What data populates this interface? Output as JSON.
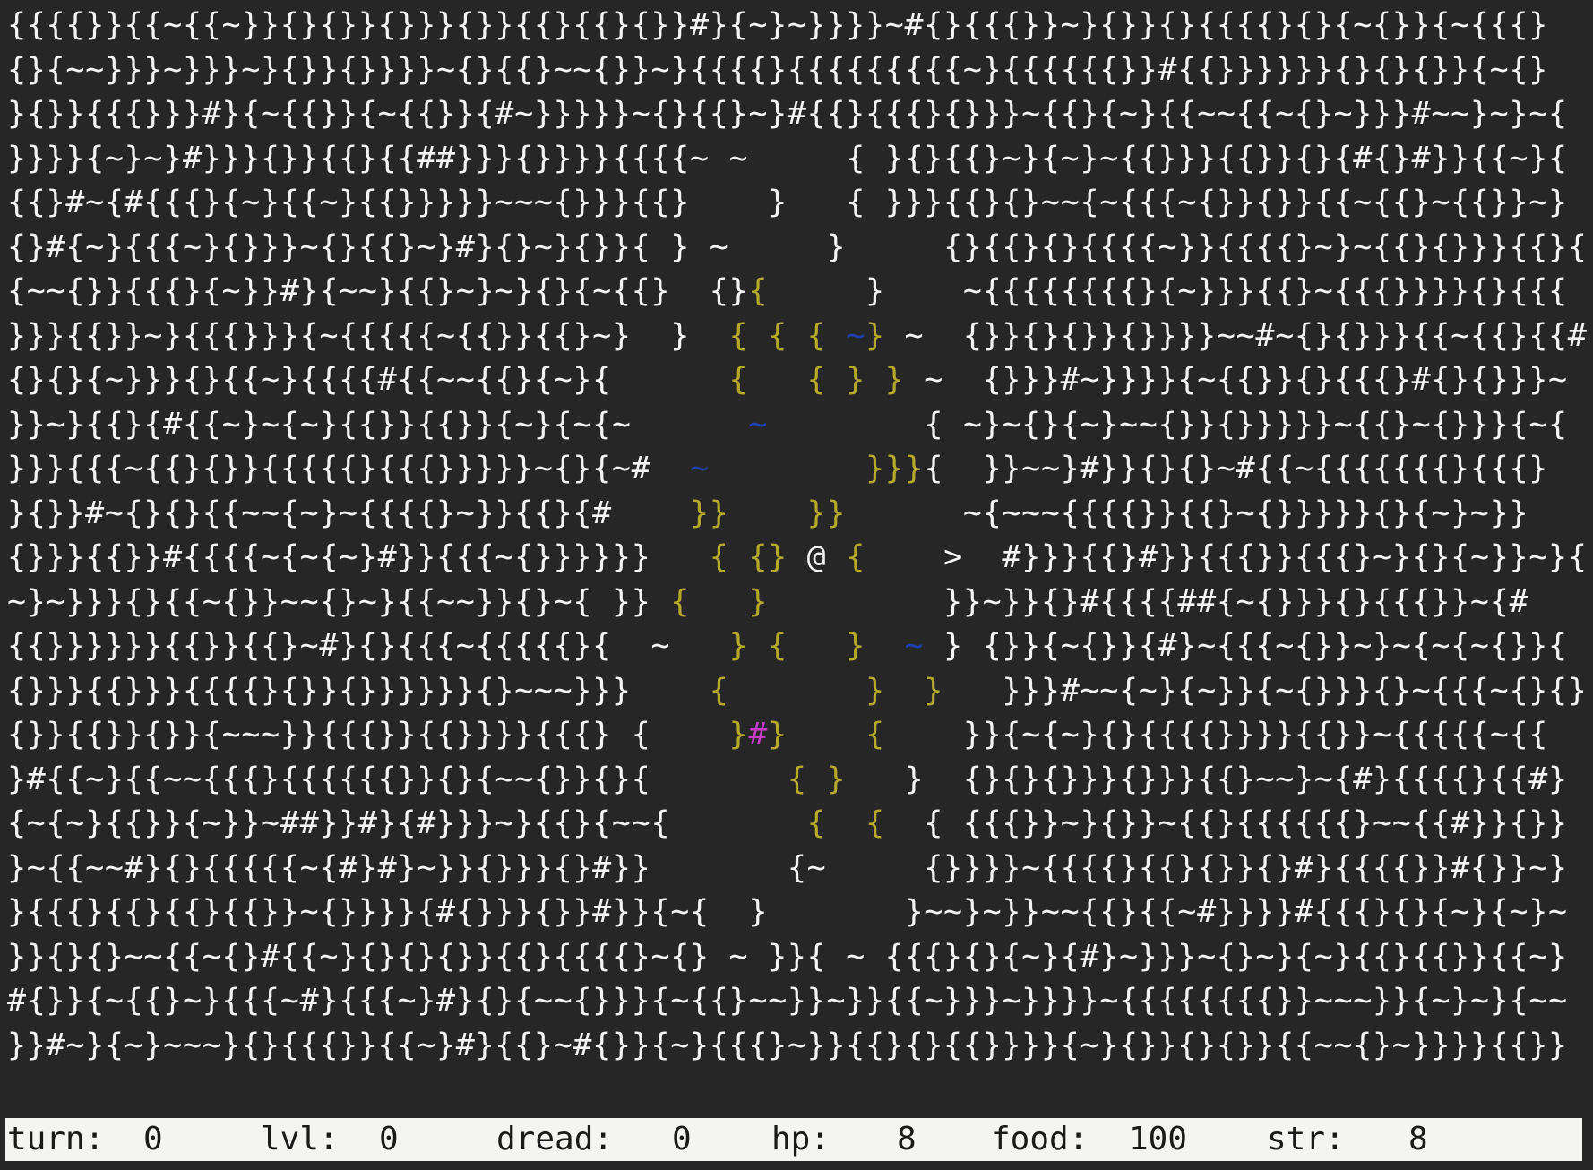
{
  "colors": {
    "background": "#262626",
    "wall": "#f4f4f4",
    "lit_floor": "#b5a82a",
    "water": "#1d3fae",
    "item": "#c63ac6",
    "status_bg": "#f4f5f3",
    "status_text": "#1a1a1a"
  },
  "legend": {
    "{": "wall",
    "}": "wall",
    "~": "water",
    "#": "wall",
    "@": "player",
    ">": "stairs-down"
  },
  "map": {
    "rows": [
      [
        [
          "{{{{}}{{~{{~}}{}{}}{}}}{}}{{}{{}{}}#}{~}~}}}}~#{}{{{}}~}{}}{}{{{{}{}{~{}}{~{{{}",
          "w"
        ]
      ],
      [
        [
          "{}{~~}}}~}}}~}{}}{}}}}~{}{{}~~{}}~}{{{{}{{{{{{{{{~}{{{{{{}}#{{}}}}}}{}{}{}}{~{}",
          "w"
        ]
      ],
      [
        [
          "}{}}{{{}}}#}{~{{}}{~{{}}{#~}}}}}~{}{{}~}#{{}{{{}{}}}~{{}{~}{{~~{{~{}~}}}#~~}~}~{",
          "w"
        ]
      ],
      [
        [
          "}}}}{~}~}#}}}{}}{{}{{##}}}{}}}}{{{{~ ~",
          "w"
        ],
        [
          "     ",
          "w"
        ],
        [
          "{ }{}{{}~}{~}~{{}}}{{}}{}{#{}#}}{{~}{",
          "w"
        ]
      ],
      [
        [
          "{{}#~{#{{{}{~}{{~}{{}}}}}~~~{}}}{{}",
          "w"
        ],
        [
          "    }   ",
          "w"
        ],
        [
          "{ }}}{{}{}~~{~{{{~{}}{}}{{~{{}~{{}}~}",
          "w"
        ]
      ],
      [
        [
          "{}#{~}{{{~}{}}}~{}{{}~}#}{}~}{}}{ } ~",
          "w"
        ],
        [
          "     }     ",
          "w"
        ],
        [
          "{}{{}{}{{{{~}}{{{{}~}~{{}{}}}{{}{",
          "w"
        ]
      ],
      [
        [
          "{~~{}}{{{}{~}}#}{~~}{{}~}~}{}{~{{}  ",
          "w"
        ],
        [
          "{}",
          "w"
        ],
        [
          "{",
          "l"
        ],
        [
          "     }    ",
          "w"
        ],
        [
          "~{{{{{{{{}{~}}}{{}~{{{}}}}{}{{{",
          "w"
        ]
      ],
      [
        [
          "}}}{{}}~}{{{}}}{~{{{{{~{{}}{{}~}  }  ",
          "w"
        ],
        [
          "{ { { ",
          "l"
        ],
        [
          "~",
          "b"
        ],
        [
          "}",
          "l"
        ],
        [
          " ~  ",
          "w"
        ],
        [
          "{}}{}{}}{}}}}~~#~{}{}}}{{~{{}{{#",
          "w"
        ]
      ],
      [
        [
          "{}{}{~}}}{}{{~}{{{{#{{~~{{}{~}{",
          "w"
        ],
        [
          "      ",
          "w"
        ],
        [
          "{   { } }",
          "l"
        ],
        [
          " ~  ",
          "w"
        ],
        [
          "{}}}#~}}}}{~{{}}{}{{{}#{}{}}}~",
          "w"
        ]
      ],
      [
        [
          "}}~}{{}{#{{~}~{~}{{}}{{}}{~}{~{~",
          "w"
        ],
        [
          "      ",
          "w"
        ],
        [
          "~",
          "b"
        ],
        [
          "        ",
          "w"
        ],
        [
          "{ ~}~{}{~}~~{}}{}}}}}~{{}~{}}}{~{",
          "w"
        ]
      ],
      [
        [
          "}}}{{{~{{}{}}{{{{{}{{{}}}}}~{}{~#  ",
          "w"
        ],
        [
          "~",
          "b"
        ],
        [
          "        ",
          "w"
        ],
        [
          "}}}",
          "l"
        ],
        [
          "{  }}~~}#}}{}{}~#{{~{{{{{{{}{{{}",
          "w"
        ]
      ],
      [
        [
          "}{}}#~{}{}{{~~{~}~{{{{}~}}{{}{#    ",
          "w"
        ],
        [
          "}}",
          "l"
        ],
        [
          "    ",
          "w"
        ],
        [
          "}}",
          "l"
        ],
        [
          "      ~{~~~{{{{}}{{}~{}}}}}{}{~}~}}",
          "w"
        ]
      ],
      [
        [
          "{}}}{{}}#{{{{~{~{~}#}}{{{~{}}}}}}   ",
          "w"
        ],
        [
          "{ {}",
          "l"
        ],
        [
          " ",
          "w"
        ],
        [
          "@",
          "p"
        ],
        [
          " ",
          "w"
        ],
        [
          "{",
          "l"
        ],
        [
          "    ",
          "w"
        ],
        [
          ">",
          "s"
        ],
        [
          "  #}}}{{}#}}{{{}}{{{}~}{}{~}}~}{",
          "w"
        ]
      ],
      [
        [
          "~}~}}}{}{{~{}}~~{}~}{{~~}}{}~{ }} ",
          "w"
        ],
        [
          "{",
          "l"
        ],
        [
          "   ",
          "w"
        ],
        [
          "}",
          "l"
        ],
        [
          "         ",
          "w"
        ],
        [
          "}}~}}{}#{{{{##{~{}}}{}{{{}}~{#",
          "w"
        ]
      ],
      [
        [
          "{{}}}}}}{{}}{{}~#}{}{{{~{{{{{}{  ~   ",
          "w"
        ],
        [
          "} {   }",
          "l"
        ],
        [
          "  ",
          "w"
        ],
        [
          "~",
          "b"
        ],
        [
          " } {}}{~{}}{#}~{{{~{}}~}~{~{~{}}{",
          "w"
        ]
      ],
      [
        [
          "{}}}{{}}}{{{{}{}}{}}}}}}{}~~~}}}    ",
          "w"
        ],
        [
          "{       }  }",
          "l"
        ],
        [
          "   }}}#~~{~}{~}}{~{}}}{}~{{{~{}{}",
          "w"
        ]
      ],
      [
        [
          "{}}{{}}{}}{~~~}}{{{}}{{}}}}{{{} {    ",
          "w"
        ],
        [
          "}",
          "l"
        ],
        [
          "#",
          "m"
        ],
        [
          "}",
          "l"
        ],
        [
          "    ",
          "w"
        ],
        [
          "{",
          "l"
        ],
        [
          "    }}{~{~}{}{{{{}}}}{{}}~{{{{{~{{",
          "w"
        ]
      ],
      [
        [
          "}#{{~}{{~~{{{}{{{{{{}}{}{~~{}}{}{       ",
          "w"
        ],
        [
          "{ }",
          "l"
        ],
        [
          "   }  {}{}{}}}{}}}{{}~~}~{#}{{{{}{{#}",
          "w"
        ]
      ],
      [
        [
          "{~{~}{{}}{~}}~##}}#}{#}}}~}{{}{~~{       ",
          "w"
        ],
        [
          "{  {",
          "l"
        ],
        [
          "  { {{{}}~}{}}~{{}{{{{{{}~~{{#}}{}}",
          "w"
        ]
      ],
      [
        [
          "}~{{~~#}{}{{{{{~{#}#}~}}{}}}{}#}}       {~     {}}}}~{{{{}{{}{}}{}#}{{{{}}#{}}~}",
          "w"
        ]
      ],
      [
        [
          "}{{{}{{}{{}{{}}~{}}}}{#{}}}{}}#}}{~{  }       }~~}~}}~~{{}{{~#}}}}#{{{}{}{~}{~}~",
          "w"
        ]
      ],
      [
        [
          "}}{}{}~~{{~{}#{{~}{}{}{}}{{}{{{{}~{} ~ }}{ ~ {{{}{}{~}{#}~}}}~{}~}{~}{{}{{}}{{~}",
          "w"
        ]
      ],
      [
        [
          "#{}}{~{{}~}{{{~#}{{{~}#}{}{~~{}}}{~{{}~~}}~}}{{~}}}~}}}}~{{{{{{{{}}~~~}}{~}~}{~~",
          "w"
        ]
      ],
      [
        [
          "}}#~}{~}~~~}{}{{{}}{{~}#}{{}~#{}}{~}{{{}~}}{{}{}{{}}}}{~}{}}{}{}}{{~~{}~}}}}{{}}",
          "w"
        ]
      ]
    ]
  },
  "status": {
    "turn_label": "turn:",
    "turn_value": "0",
    "lvl_label": "lvl:",
    "lvl_value": "0",
    "dread_label": "dread:",
    "dread_value": "0",
    "hp_label": "hp:",
    "hp_value": "8",
    "food_label": "food:",
    "food_value": "100",
    "str_label": "str:",
    "str_value": "8"
  }
}
